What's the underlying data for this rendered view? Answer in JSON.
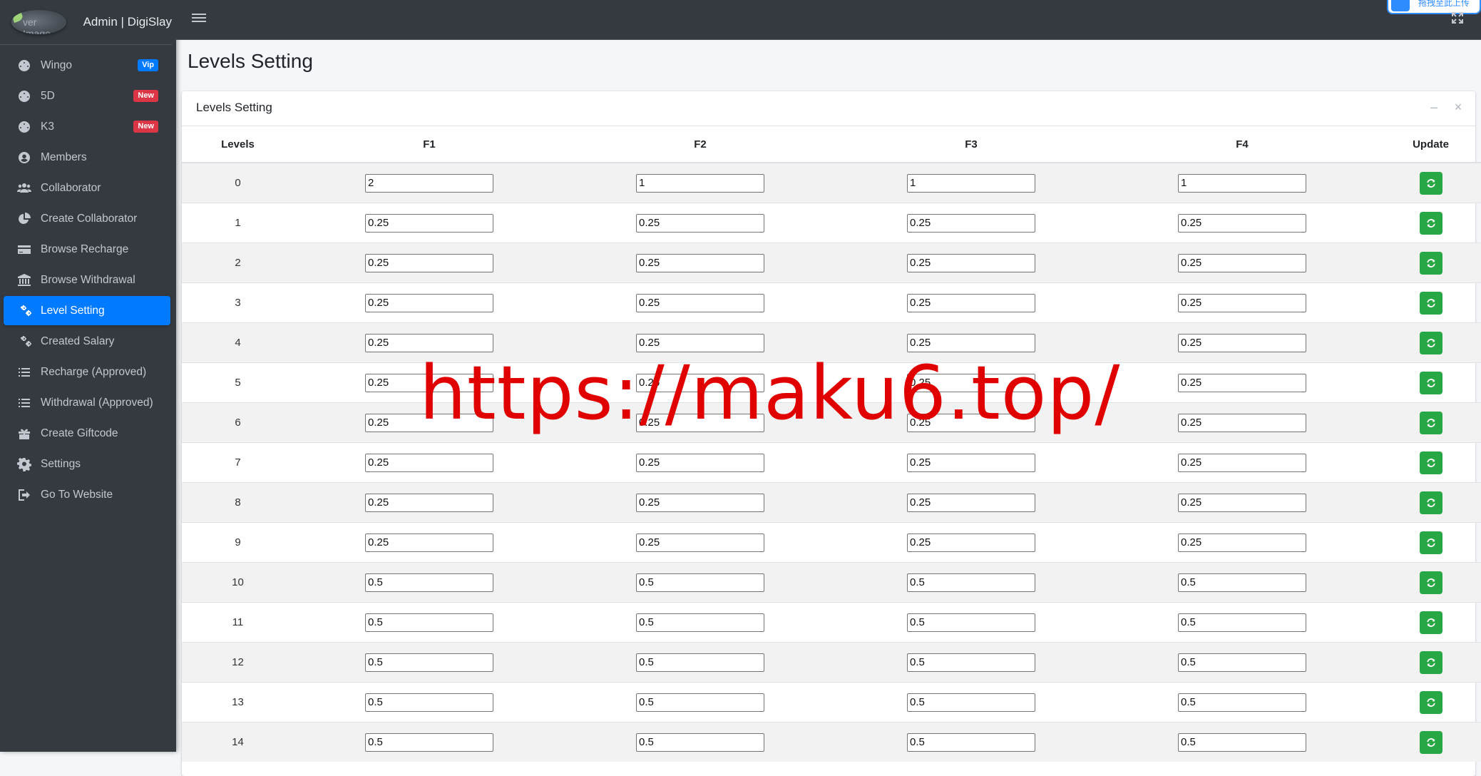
{
  "brand": {
    "logo_alt": "ver Image",
    "title": "Admin | DigiSlay"
  },
  "sidebar": {
    "items": [
      {
        "label": "Wingo",
        "badge": "Vip"
      },
      {
        "label": "5D",
        "badge": "New"
      },
      {
        "label": "K3",
        "badge": "New"
      },
      {
        "label": "Members"
      },
      {
        "label": "Collaborator"
      },
      {
        "label": "Create Collaborator"
      },
      {
        "label": "Browse Recharge"
      },
      {
        "label": "Browse Withdrawal"
      },
      {
        "label": "Level Setting",
        "active": true
      },
      {
        "label": "Created Salary"
      },
      {
        "label": "Recharge (Approved)"
      },
      {
        "label": "Withdrawal (Approved)"
      },
      {
        "label": "Create Giftcode"
      },
      {
        "label": "Settings"
      },
      {
        "label": "Go To Website"
      }
    ]
  },
  "header": {
    "floating_widget_text": "拖拽至此上传"
  },
  "page": {
    "title": "Levels Setting"
  },
  "card": {
    "title": "Levels Setting",
    "minimize": "–",
    "close": "×"
  },
  "table": {
    "columns": [
      "Levels",
      "F1",
      "F2",
      "F3",
      "F4",
      "Update"
    ],
    "rows": [
      [
        "0",
        "2",
        "1",
        "1",
        "1"
      ],
      [
        "1",
        "0.25",
        "0.25",
        "0.25",
        "0.25"
      ],
      [
        "2",
        "0.25",
        "0.25",
        "0.25",
        "0.25"
      ],
      [
        "3",
        "0.25",
        "0.25",
        "0.25",
        "0.25"
      ],
      [
        "4",
        "0.25",
        "0.25",
        "0.25",
        "0.25"
      ],
      [
        "5",
        "0.25",
        "0.25",
        "0.25",
        "0.25"
      ],
      [
        "6",
        "0.25",
        "0.25",
        "0.25",
        "0.25"
      ],
      [
        "7",
        "0.25",
        "0.25",
        "0.25",
        "0.25"
      ],
      [
        "8",
        "0.25",
        "0.25",
        "0.25",
        "0.25"
      ],
      [
        "9",
        "0.25",
        "0.25",
        "0.25",
        "0.25"
      ],
      [
        "10",
        "0.5",
        "0.5",
        "0.5",
        "0.5"
      ],
      [
        "11",
        "0.5",
        "0.5",
        "0.5",
        "0.5"
      ],
      [
        "12",
        "0.5",
        "0.5",
        "0.5",
        "0.5"
      ],
      [
        "13",
        "0.5",
        "0.5",
        "0.5",
        "0.5"
      ],
      [
        "14",
        "0.5",
        "0.5",
        "0.5",
        "0.5"
      ]
    ]
  },
  "overlay": {
    "watermark": "https://maku6.top/"
  },
  "colors": {
    "sidebar_bg": "#343a40",
    "active": "#007bff",
    "update_button": "#28a745",
    "watermark": "#e00000"
  }
}
